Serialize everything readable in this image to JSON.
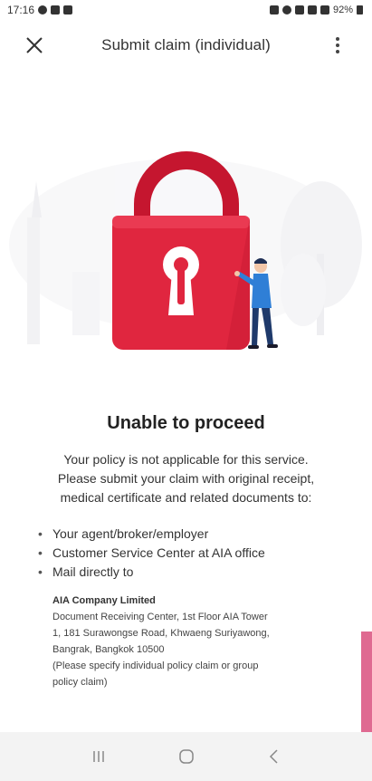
{
  "status_bar": {
    "time": "17:16",
    "battery": "92%"
  },
  "app_bar": {
    "title": "Submit claim (individual)"
  },
  "message": {
    "headline": "Unable to proceed",
    "body_lines": [
      "Your policy is not applicable for this service.",
      "Please submit your claim with original receipt,",
      "medical certificate and related documents to:"
    ],
    "bullets": [
      "Your agent/broker/employer",
      "Customer Service Center at AIA office",
      "Mail directly to"
    ],
    "address": {
      "company": "AIA Company Limited",
      "lines": [
        "Document Receiving Center, 1st Floor AIA Tower",
        "1, 181 Surawongse Road, Khwaeng Suriyawong,",
        "Bangrak, Bangkok 10500",
        "(Please specify individual policy claim or group",
        "policy claim)"
      ]
    }
  },
  "colors": {
    "lock_red": "#e0263f",
    "lock_dark": "#b8122b",
    "pink_edge": "#d9507e",
    "navbar_bg": "#f3f3f3"
  },
  "icons": {
    "close": "close-icon",
    "more": "more-vertical-icon",
    "nav_recents": "recents-icon",
    "nav_home": "home-icon",
    "nav_back": "back-icon"
  }
}
